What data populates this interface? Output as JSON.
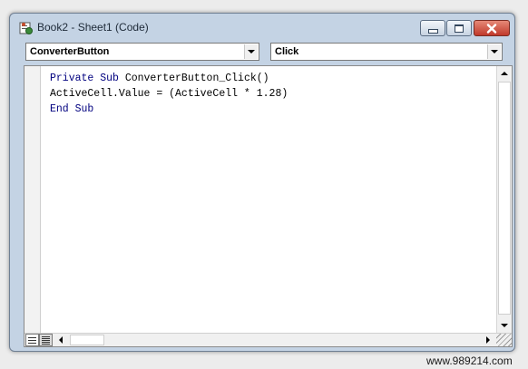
{
  "window": {
    "title": "Book2 - Sheet1 (Code)",
    "icon": "vba-code-icon"
  },
  "combos": {
    "object": "ConverterButton",
    "procedure": "Click"
  },
  "code": {
    "lines": [
      {
        "kw": "Private Sub",
        "rest": " ConverterButton_Click()"
      },
      {
        "kw": "",
        "rest": "ActiveCell.Value = (ActiveCell * 1.28)"
      },
      {
        "kw": "End Sub",
        "rest": ""
      }
    ]
  },
  "colors": {
    "keyword": "#00007f",
    "close_button": "#c0392b"
  },
  "watermark": {
    "text": "www.989214.com"
  }
}
